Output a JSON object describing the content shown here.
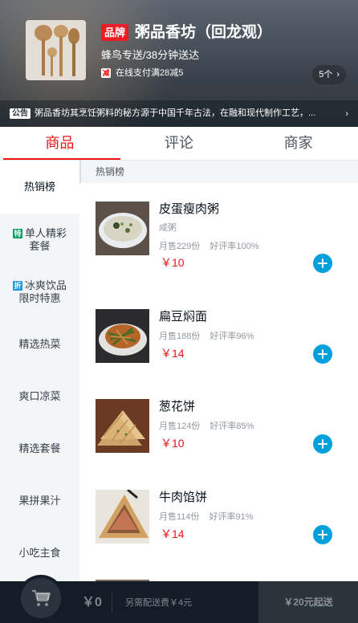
{
  "seller": {
    "brand_tag": "品牌",
    "name": "粥品香坊（回龙观）",
    "delivery": "蜂鸟专送/38分钟送达",
    "support_badge": "减",
    "support_text": "在线支付满28减5",
    "support_count": "5个",
    "bulletin_badge": "公告",
    "bulletin_text": "粥品香坊其烹饪粥料的秘方源于中国千年古法，在融和现代制作工艺，..."
  },
  "tabs": [
    {
      "label": "商品",
      "active": true
    },
    {
      "label": "评论",
      "active": false
    },
    {
      "label": "商家",
      "active": false
    }
  ],
  "menu": [
    {
      "label": "热销榜",
      "tag": "",
      "active": true
    },
    {
      "label": "单人精彩套餐",
      "tag": "特"
    },
    {
      "label": "冰爽饮品限时特惠",
      "tag": "折"
    },
    {
      "label": "精选热菜",
      "tag": ""
    },
    {
      "label": "爽口凉菜",
      "tag": ""
    },
    {
      "label": "精选套餐",
      "tag": ""
    },
    {
      "label": "果拼果汁",
      "tag": ""
    },
    {
      "label": "小吃主食",
      "tag": ""
    }
  ],
  "section_title": "热销榜",
  "foods": [
    {
      "name": "皮蛋瘦肉粥",
      "description": "咸粥",
      "sell": "月售229份",
      "rating": "好评率100%",
      "price": "￥10"
    },
    {
      "name": "扁豆焖面",
      "description": "",
      "sell": "月售188份",
      "rating": "好评率96%",
      "price": "￥14"
    },
    {
      "name": "葱花饼",
      "description": "",
      "sell": "月售124份",
      "rating": "好评率85%",
      "price": "￥10"
    },
    {
      "name": "牛肉馅饼",
      "description": "",
      "sell": "月售114份",
      "rating": "好评率91%",
      "price": "￥14"
    }
  ],
  "cart": {
    "total": "￥0",
    "delivery_fee": "另需配送费￥4元",
    "min_price": "￥20元起送"
  },
  "colors": {
    "accent_red": "#f01414",
    "add_button_blue": "#00a0dc",
    "cart_bg": "#141d27"
  }
}
